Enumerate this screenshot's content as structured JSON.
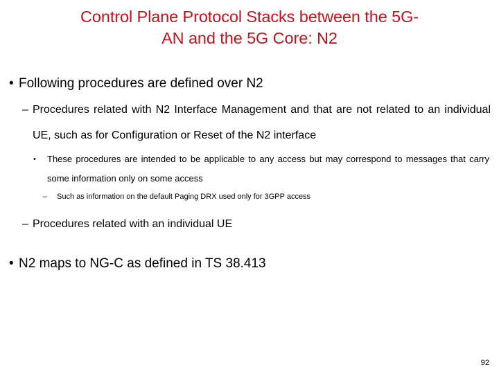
{
  "slide": {
    "page_number": "92",
    "title_color": "#C2121C",
    "background_color": "#FFFFFF",
    "title": {
      "line1": "Control Plane Protocol Stacks between the 5G-",
      "line2": "AN and the 5G Core: N2"
    },
    "bullets": {
      "b1": {
        "marker": "•",
        "text": "Following procedures are defined over N2"
      },
      "b2": {
        "marker": "–",
        "text": "Procedures related with N2 Interface Management and that are not related to an individual UE, such as for Configuration or Reset of the N2 interface"
      },
      "b3": {
        "marker": "•",
        "text": "These procedures are intended to be applicable to any access but may correspond to messages that carry some information only on some access"
      },
      "b4": {
        "marker": "–",
        "text": "Such as information on the default Paging DRX used only for 3GPP access"
      },
      "b5": {
        "marker": "–",
        "text": "Procedures related with an individual UE"
      },
      "b6": {
        "marker": "•",
        "text": "N2 maps to NG-C as defined in TS 38.413"
      }
    }
  }
}
